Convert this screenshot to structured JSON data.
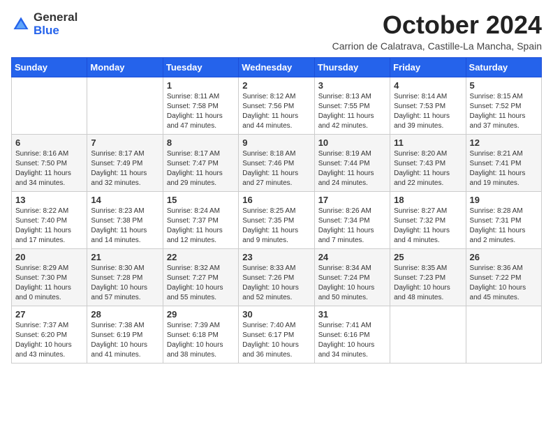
{
  "header": {
    "logo_general": "General",
    "logo_blue": "Blue",
    "month_title": "October 2024",
    "subtitle": "Carrion de Calatrava, Castille-La Mancha, Spain"
  },
  "days_of_week": [
    "Sunday",
    "Monday",
    "Tuesday",
    "Wednesday",
    "Thursday",
    "Friday",
    "Saturday"
  ],
  "weeks": [
    [
      {
        "day": "",
        "info": ""
      },
      {
        "day": "",
        "info": ""
      },
      {
        "day": "1",
        "info": "Sunrise: 8:11 AM\nSunset: 7:58 PM\nDaylight: 11 hours and 47 minutes."
      },
      {
        "day": "2",
        "info": "Sunrise: 8:12 AM\nSunset: 7:56 PM\nDaylight: 11 hours and 44 minutes."
      },
      {
        "day": "3",
        "info": "Sunrise: 8:13 AM\nSunset: 7:55 PM\nDaylight: 11 hours and 42 minutes."
      },
      {
        "day": "4",
        "info": "Sunrise: 8:14 AM\nSunset: 7:53 PM\nDaylight: 11 hours and 39 minutes."
      },
      {
        "day": "5",
        "info": "Sunrise: 8:15 AM\nSunset: 7:52 PM\nDaylight: 11 hours and 37 minutes."
      }
    ],
    [
      {
        "day": "6",
        "info": "Sunrise: 8:16 AM\nSunset: 7:50 PM\nDaylight: 11 hours and 34 minutes."
      },
      {
        "day": "7",
        "info": "Sunrise: 8:17 AM\nSunset: 7:49 PM\nDaylight: 11 hours and 32 minutes."
      },
      {
        "day": "8",
        "info": "Sunrise: 8:17 AM\nSunset: 7:47 PM\nDaylight: 11 hours and 29 minutes."
      },
      {
        "day": "9",
        "info": "Sunrise: 8:18 AM\nSunset: 7:46 PM\nDaylight: 11 hours and 27 minutes."
      },
      {
        "day": "10",
        "info": "Sunrise: 8:19 AM\nSunset: 7:44 PM\nDaylight: 11 hours and 24 minutes."
      },
      {
        "day": "11",
        "info": "Sunrise: 8:20 AM\nSunset: 7:43 PM\nDaylight: 11 hours and 22 minutes."
      },
      {
        "day": "12",
        "info": "Sunrise: 8:21 AM\nSunset: 7:41 PM\nDaylight: 11 hours and 19 minutes."
      }
    ],
    [
      {
        "day": "13",
        "info": "Sunrise: 8:22 AM\nSunset: 7:40 PM\nDaylight: 11 hours and 17 minutes."
      },
      {
        "day": "14",
        "info": "Sunrise: 8:23 AM\nSunset: 7:38 PM\nDaylight: 11 hours and 14 minutes."
      },
      {
        "day": "15",
        "info": "Sunrise: 8:24 AM\nSunset: 7:37 PM\nDaylight: 11 hours and 12 minutes."
      },
      {
        "day": "16",
        "info": "Sunrise: 8:25 AM\nSunset: 7:35 PM\nDaylight: 11 hours and 9 minutes."
      },
      {
        "day": "17",
        "info": "Sunrise: 8:26 AM\nSunset: 7:34 PM\nDaylight: 11 hours and 7 minutes."
      },
      {
        "day": "18",
        "info": "Sunrise: 8:27 AM\nSunset: 7:32 PM\nDaylight: 11 hours and 4 minutes."
      },
      {
        "day": "19",
        "info": "Sunrise: 8:28 AM\nSunset: 7:31 PM\nDaylight: 11 hours and 2 minutes."
      }
    ],
    [
      {
        "day": "20",
        "info": "Sunrise: 8:29 AM\nSunset: 7:30 PM\nDaylight: 11 hours and 0 minutes."
      },
      {
        "day": "21",
        "info": "Sunrise: 8:30 AM\nSunset: 7:28 PM\nDaylight: 10 hours and 57 minutes."
      },
      {
        "day": "22",
        "info": "Sunrise: 8:32 AM\nSunset: 7:27 PM\nDaylight: 10 hours and 55 minutes."
      },
      {
        "day": "23",
        "info": "Sunrise: 8:33 AM\nSunset: 7:26 PM\nDaylight: 10 hours and 52 minutes."
      },
      {
        "day": "24",
        "info": "Sunrise: 8:34 AM\nSunset: 7:24 PM\nDaylight: 10 hours and 50 minutes."
      },
      {
        "day": "25",
        "info": "Sunrise: 8:35 AM\nSunset: 7:23 PM\nDaylight: 10 hours and 48 minutes."
      },
      {
        "day": "26",
        "info": "Sunrise: 8:36 AM\nSunset: 7:22 PM\nDaylight: 10 hours and 45 minutes."
      }
    ],
    [
      {
        "day": "27",
        "info": "Sunrise: 7:37 AM\nSunset: 6:20 PM\nDaylight: 10 hours and 43 minutes."
      },
      {
        "day": "28",
        "info": "Sunrise: 7:38 AM\nSunset: 6:19 PM\nDaylight: 10 hours and 41 minutes."
      },
      {
        "day": "29",
        "info": "Sunrise: 7:39 AM\nSunset: 6:18 PM\nDaylight: 10 hours and 38 minutes."
      },
      {
        "day": "30",
        "info": "Sunrise: 7:40 AM\nSunset: 6:17 PM\nDaylight: 10 hours and 36 minutes."
      },
      {
        "day": "31",
        "info": "Sunrise: 7:41 AM\nSunset: 6:16 PM\nDaylight: 10 hours and 34 minutes."
      },
      {
        "day": "",
        "info": ""
      },
      {
        "day": "",
        "info": ""
      }
    ]
  ]
}
